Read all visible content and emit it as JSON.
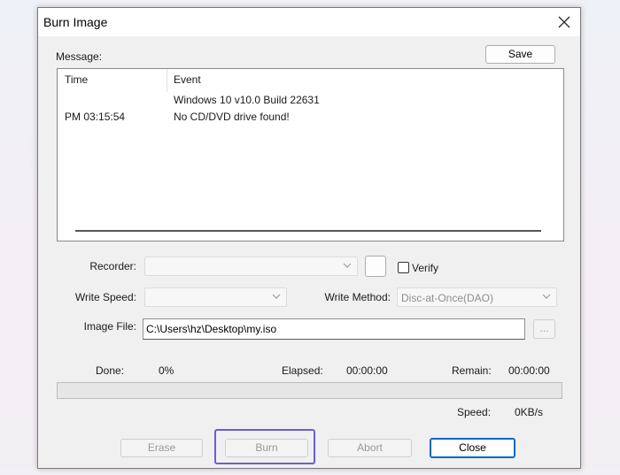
{
  "window": {
    "title": "Burn Image"
  },
  "message": {
    "label": "Message:",
    "save_label": "Save",
    "columns": [
      "Time",
      "Event"
    ],
    "rows": [
      {
        "time": "",
        "event": "Windows 10 v10.0 Build 22631"
      },
      {
        "time": "PM 03:15:54",
        "event": "No CD/DVD drive found!"
      }
    ]
  },
  "form": {
    "recorder_label": "Recorder:",
    "recorder_value": "",
    "verify_label": "Verify",
    "verify_checked": false,
    "write_speed_label": "Write Speed:",
    "write_speed_value": "",
    "write_method_label": "Write Method:",
    "write_method_value": "Disc-at-Once(DAO)",
    "image_file_label": "Image File:",
    "image_file_value": "C:\\Users\\hz\\Desktop\\my.iso",
    "browse_label": "..."
  },
  "status": {
    "done_label": "Done:",
    "done_value": "0%",
    "progress_fraction": 0,
    "elapsed_label": "Elapsed:",
    "elapsed_value": "00:00:00",
    "remain_label": "Remain:",
    "remain_value": "00:00:00",
    "speed_label": "Speed:",
    "speed_value": "0KB/s"
  },
  "buttons": {
    "erase": "Erase",
    "burn": "Burn",
    "abort": "Abort",
    "close": "Close"
  },
  "colors": {
    "highlight": "#6b5fd3",
    "default_button_border": "#0067c0"
  }
}
